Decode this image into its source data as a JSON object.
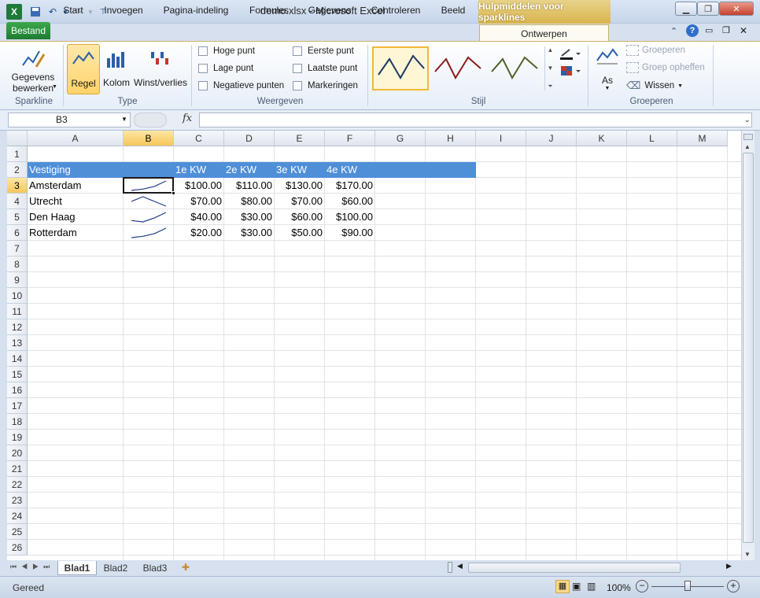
{
  "window": {
    "title": "demo.xlsx - Microsoft Excel",
    "context_tab": "Hulpmiddelen voor sparklines",
    "logo_letter": "X"
  },
  "tabs": {
    "file": "Bestand",
    "items": [
      "Start",
      "Invoegen",
      "Pagina-indeling",
      "Formules",
      "Gegevens",
      "Controleren",
      "Beeld"
    ],
    "active": "Ontwerpen"
  },
  "ribbon": {
    "sparkline": {
      "edit_line1": "Gegevens",
      "edit_line2": "bewerken",
      "label": "Sparkline"
    },
    "type": {
      "line": "Regel",
      "column": "Kolom",
      "winloss": "Winst/verlies",
      "label": "Type"
    },
    "show": {
      "high": "Hoge punt",
      "low": "Lage punt",
      "negative": "Negatieve punten",
      "first": "Eerste punt",
      "last": "Laatste punt",
      "markers": "Markeringen",
      "label": "Weergeven"
    },
    "style": {
      "label": "Stijl",
      "colors": [
        "#1f3864",
        "#8b1a1a",
        "#4f6228"
      ]
    },
    "group": {
      "axis": "As",
      "group": "Groeperen",
      "ungroup": "Groep opheffen",
      "clear": "Wissen",
      "label": "Groeperen"
    }
  },
  "formula_bar": {
    "name_box": "B3",
    "fx": "fx",
    "formula": ""
  },
  "columns": [
    "A",
    "B",
    "C",
    "D",
    "E",
    "F",
    "G",
    "H",
    "I",
    "J",
    "K",
    "L",
    "M"
  ],
  "rows": [
    "1",
    "2",
    "3",
    "4",
    "5",
    "6",
    "7",
    "8",
    "9",
    "10",
    "11",
    "12",
    "13",
    "14",
    "15",
    "16",
    "17",
    "18",
    "19",
    "20",
    "21",
    "22",
    "23",
    "24",
    "25",
    "26"
  ],
  "table": {
    "header": [
      "Vestiging",
      "",
      "1e KW",
      "2e KW",
      "3e KW",
      "4e KW"
    ],
    "rows": [
      {
        "name": "Amsterdam",
        "vals": [
          "$100.00",
          "$110.00",
          "$130.00",
          "$170.00"
        ],
        "spark": [
          100,
          110,
          130,
          170
        ]
      },
      {
        "name": "Utrecht",
        "vals": [
          "$70.00",
          "$80.00",
          "$70.00",
          "$60.00"
        ],
        "spark": [
          70,
          80,
          70,
          60
        ]
      },
      {
        "name": "Den Haag",
        "vals": [
          "$40.00",
          "$30.00",
          "$60.00",
          "$100.00"
        ],
        "spark": [
          40,
          30,
          60,
          100
        ]
      },
      {
        "name": "Rotterdam",
        "vals": [
          "$20.00",
          "$30.00",
          "$50.00",
          "$90.00"
        ],
        "spark": [
          20,
          30,
          50,
          90
        ]
      }
    ],
    "header_color": "#4f8fd8",
    "sparkline_color": "#1f3e8c"
  },
  "sheets": [
    "Blad1",
    "Blad2",
    "Blad3"
  ],
  "status": {
    "ready": "Gereed",
    "zoom": "100%"
  }
}
